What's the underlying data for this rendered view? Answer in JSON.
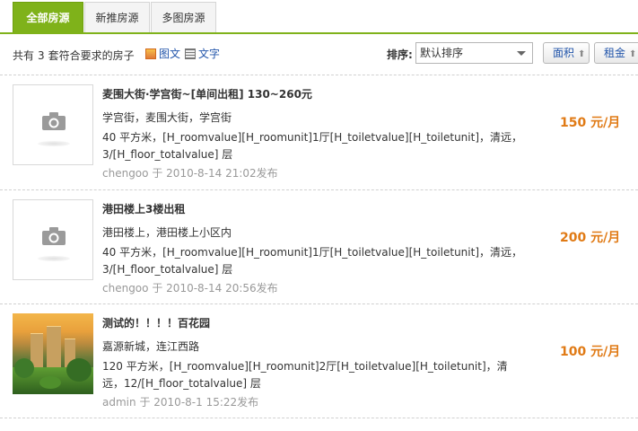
{
  "tabs": [
    {
      "label": "全部房源"
    },
    {
      "label": "新推房源"
    },
    {
      "label": "多图房源"
    }
  ],
  "toolbar": {
    "count_prefix": "共有",
    "count": "3",
    "count_suffix": "套符合要求的房子",
    "view_picture": "图文",
    "view_text": "文字",
    "sort_label": "排序:",
    "sort_selected": "默认排序",
    "sort_area": "面积",
    "sort_rent": "租金"
  },
  "listings": [
    {
      "title": "麦围大街·学宫街~[单间出租] 130~260元",
      "address": "学宫街，麦围大街，学宫街",
      "description": "40 平方米，[H_roomvalue][H_roomunit]1厅[H_toiletvalue][H_toiletunit]，清远，3/[H_floor_totalvalue] 层",
      "author": "chengoo",
      "time_prefix": "于",
      "time": "2010-8-14 21:02发布",
      "price": "150 元/月",
      "image": "placeholder-camera"
    },
    {
      "title": "港田楼上3楼出租",
      "address": "港田楼上，港田楼上小区内",
      "description": "40 平方米，[H_roomvalue][H_roomunit]1厅[H_toiletvalue][H_toiletunit]，清远，3/[H_floor_totalvalue] 层",
      "author": "chengoo",
      "time_prefix": "于",
      "time": "2010-8-14 20:56发布",
      "price": "200 元/月",
      "image": "placeholder-camera"
    },
    {
      "title": "测试的！！！！百花园",
      "address": "嘉源新城，连江西路",
      "description": "120 平方米，[H_roomvalue][H_roomunit]2厅[H_toiletvalue][H_toiletunit]，清远，12/[H_floor_totalvalue] 层",
      "author": "admin",
      "time_prefix": "于",
      "time": "2010-8-1 15:22发布",
      "price": "100 元/月",
      "image": "property-photo"
    }
  ],
  "colors": {
    "accent_green": "#7fb21a",
    "price_orange": "#e07a15",
    "link_blue": "#2255aa"
  }
}
